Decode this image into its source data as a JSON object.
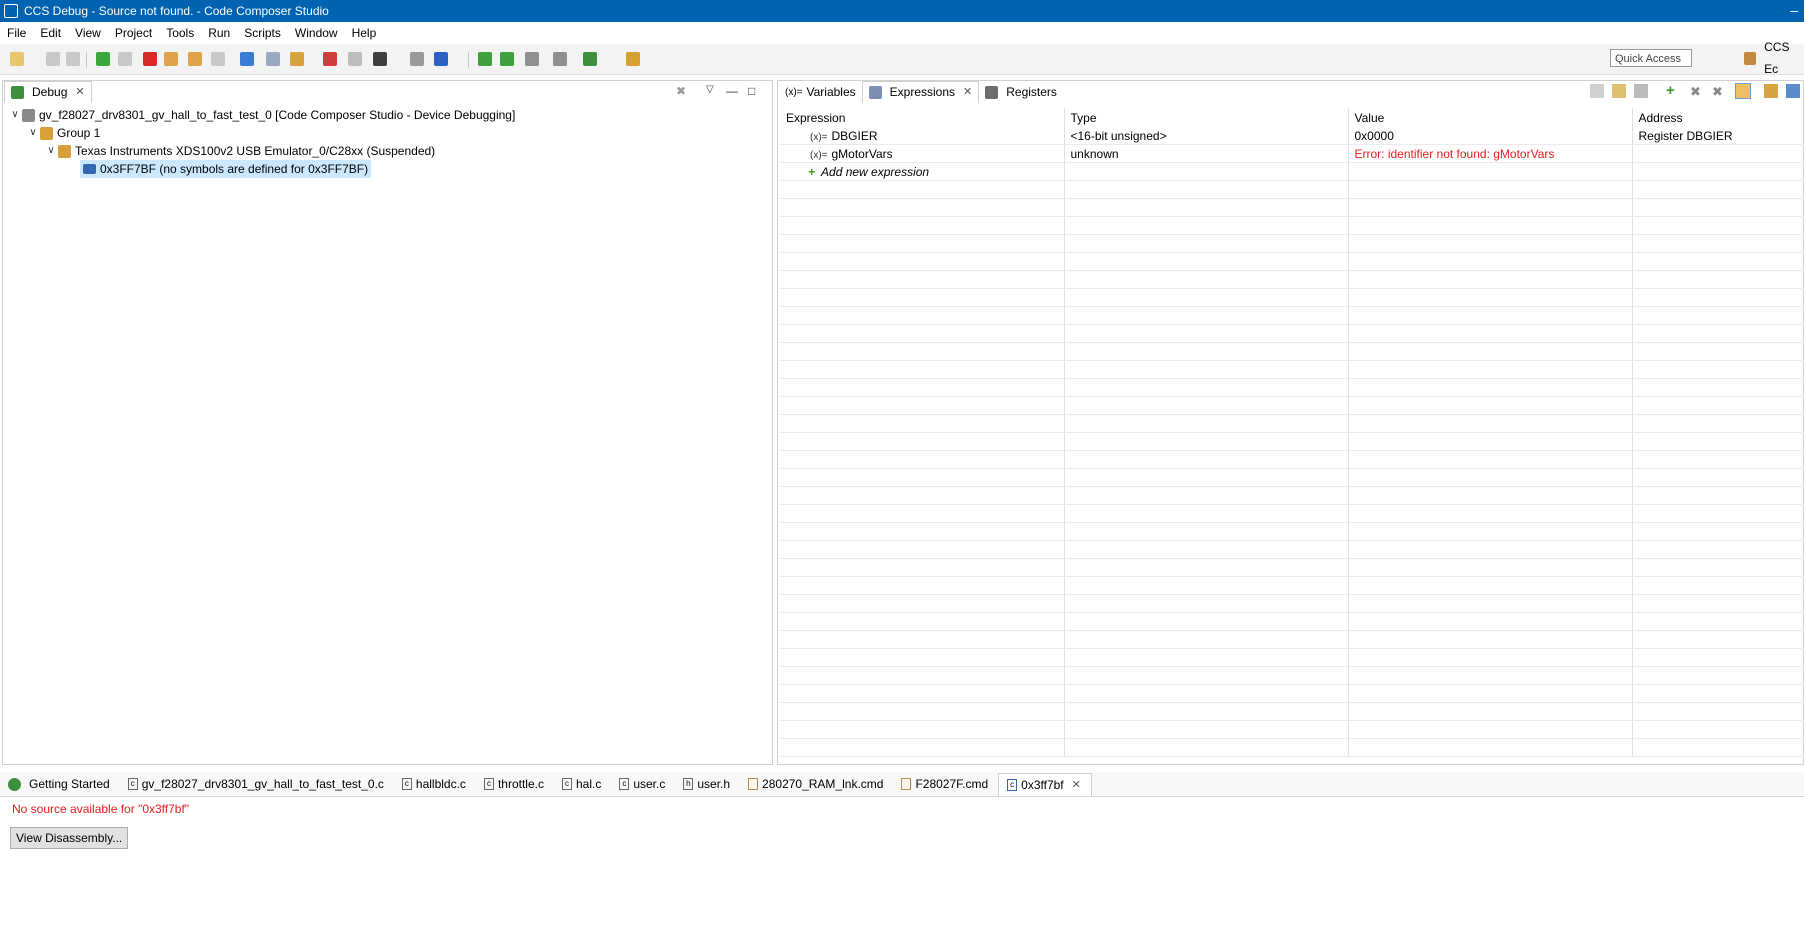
{
  "window": {
    "title": "CCS Debug - Source not found. - Code Composer Studio"
  },
  "menu": [
    "File",
    "Edit",
    "View",
    "Project",
    "Tools",
    "Run",
    "Scripts",
    "Window",
    "Help"
  ],
  "toolbar": {
    "quick_access_placeholder": "Quick Access",
    "perspective_label": "CCS Ec"
  },
  "debug_view": {
    "tab_label": "Debug",
    "tree": [
      {
        "label": "gv_f28027_drv8301_gv_hall_to_fast_test_0 [Code Composer Studio - Device Debugging]"
      },
      {
        "label": "Group 1"
      },
      {
        "label": "Texas Instruments XDS100v2 USB Emulator_0/C28xx (Suspended)"
      },
      {
        "label": "0x3FF7BF  (no symbols are defined for 0x3FF7BF)"
      }
    ]
  },
  "right_view": {
    "tabs": [
      {
        "label": "Variables",
        "icon": "(x)="
      },
      {
        "label": "Expressions",
        "icon": "expressions-icon"
      },
      {
        "label": "Registers",
        "icon": "registers-icon"
      }
    ],
    "columns": [
      "Expression",
      "Type",
      "Value",
      "Address"
    ],
    "rows": [
      {
        "icon": "(x)=",
        "expression": "DBGIER",
        "type": "<16-bit unsigned>",
        "value": "0x0000",
        "address": "Register DBGIER"
      },
      {
        "icon": "(x)=",
        "expression": "gMotorVars",
        "type": "unknown",
        "value": "Error: identifier not found: gMotorVars",
        "address": ""
      }
    ],
    "add_expression": "Add new expression"
  },
  "editor_tabs": [
    {
      "label": "Getting Started"
    },
    {
      "label": "gv_f28027_drv8301_gv_hall_to_fast_test_0.c"
    },
    {
      "label": "hallbldc.c"
    },
    {
      "label": "throttle.c"
    },
    {
      "label": "hal.c"
    },
    {
      "label": "user.c"
    },
    {
      "label": "user.h"
    },
    {
      "label": "280270_RAM_lnk.cmd"
    },
    {
      "label": "F28027F.cmd"
    },
    {
      "label": "0x3ff7bf"
    }
  ],
  "editor": {
    "message": "No source available for \"0x3ff7bf\"",
    "button": "View Disassembly..."
  },
  "colors": {
    "titlebar": "#0063b1",
    "error": "#e02020",
    "selection": "#cce8ff"
  }
}
